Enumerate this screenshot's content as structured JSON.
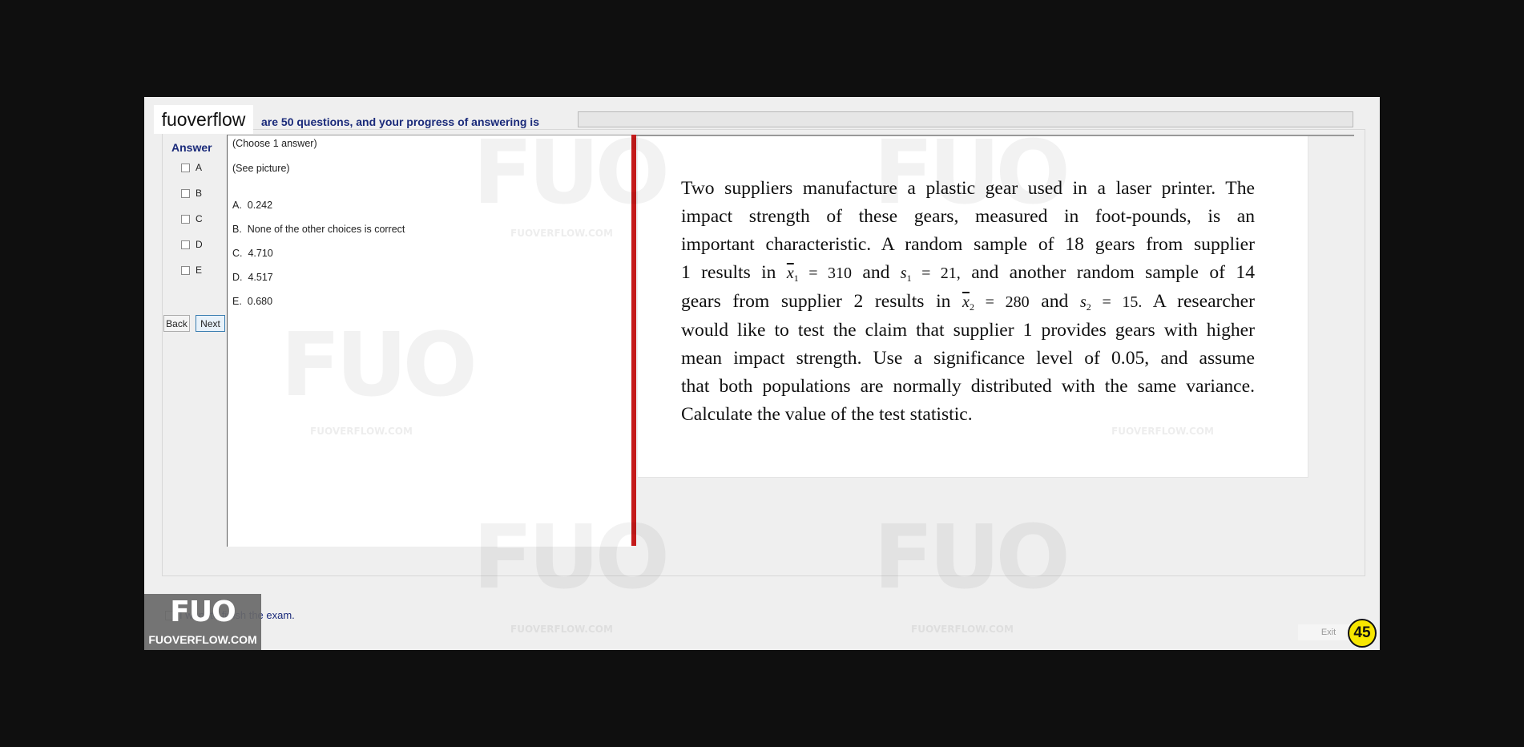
{
  "brand": {
    "name": "fuoverflow"
  },
  "header": {
    "progress_label": "are 50 questions, and your progress of answering is",
    "progress": 0
  },
  "answer_panel": {
    "title": "Answer",
    "options": [
      "A",
      "B",
      "C",
      "D",
      "E"
    ],
    "back_label": "Back",
    "next_label": "Next"
  },
  "question": {
    "instruction": "(Choose 1 answer)",
    "see_picture": "(See picture)",
    "choices": [
      {
        "letter": "A.",
        "text": "0.242"
      },
      {
        "letter": "B.",
        "text": "None of the other choices is correct"
      },
      {
        "letter": "C.",
        "text": "4.710"
      },
      {
        "letter": "D.",
        "text": "4.517"
      },
      {
        "letter": "E.",
        "text": "0.680"
      }
    ]
  },
  "problem": {
    "line1": "Two suppliers manufacture a plastic gear used in a laser printer. The",
    "line2": "impact strength of these gears, measured in foot-pounds, is an",
    "line3": "important characteristic. A random sample of 18 gears from supplier",
    "line4_pre": "1 results in",
    "x1_sym": "x",
    "sub1": "1",
    "x1_eq": " = 310",
    "and": "and",
    "s_sym": "s",
    "s1_eq": " = 21,",
    "line4_post": "and another random sample of 14",
    "line5_pre": "gears from supplier 2 results in",
    "sub2": "2",
    "x2_eq": " = 280",
    "s2_eq": " = 15.",
    "line5_post": "A researcher",
    "line6": "would like to test the claim that supplier 1 provides gears with higher",
    "line7": "mean impact strength. Use a significance level of 0.05, and assume",
    "line8": "that both populations are normally distributed with the same variance.",
    "line9": "Calculate the value of the test statistic."
  },
  "footer": {
    "finish_label": "I want to finish the exam.",
    "exit_label": "Exit",
    "timer": "45",
    "logo_mark": "FUO",
    "logo_text": "FUOVERFLOW.COM"
  },
  "watermark": {
    "mark": "FUO",
    "text": "FUOVERFLOW.COM"
  }
}
